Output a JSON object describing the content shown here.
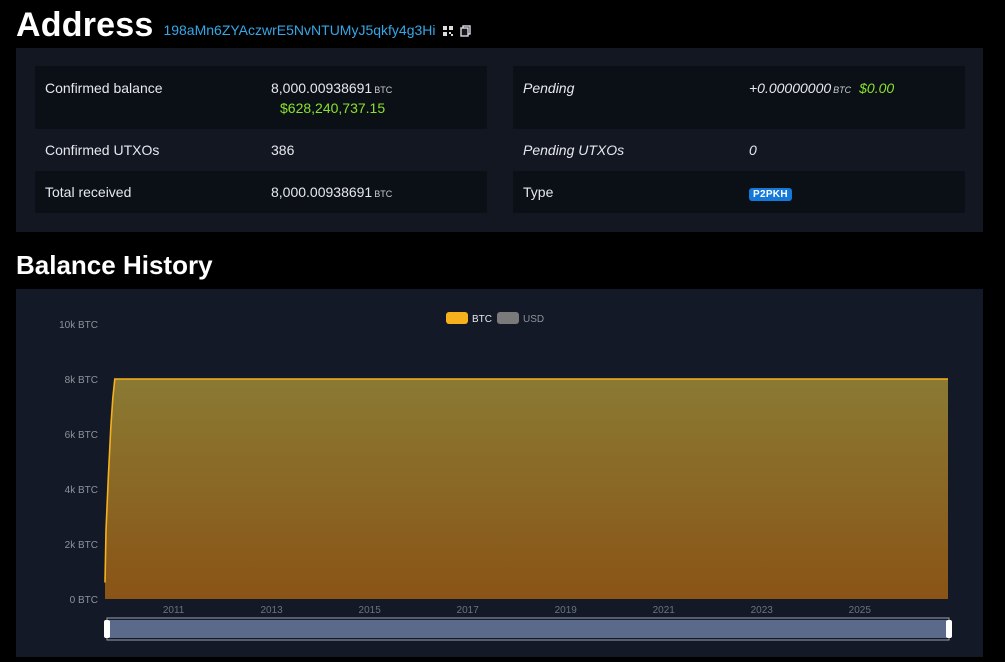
{
  "address": {
    "title": "Address",
    "hash": "198aMn6ZYAczwrE5NvNTUMyJ5qkfy4g3Hi"
  },
  "summary": {
    "confirmed_balance": {
      "label": "Confirmed balance",
      "value": "8,000.00938691",
      "unit": "BTC",
      "usd": "$628,240,737.15"
    },
    "pending": {
      "label": "Pending",
      "value": "+0.00000000",
      "unit": "BTC",
      "usd": "$0.00"
    },
    "confirmed_utxos": {
      "label": "Confirmed UTXOs",
      "value": "386"
    },
    "pending_utxos": {
      "label": "Pending UTXOs",
      "value": "0"
    },
    "total_received": {
      "label": "Total received",
      "value": "8,000.00938691",
      "unit": "BTC"
    },
    "type": {
      "label": "Type",
      "value": "P2PKH"
    }
  },
  "balance_history": {
    "title": "Balance History"
  },
  "colors": {
    "btc": "#f7b11c",
    "usd": "#7a7a7a",
    "accent": "#35a7e8",
    "usd_text": "#8ae22b",
    "badge": "#1479d8"
  },
  "chart_data": {
    "type": "area",
    "title": "",
    "xlabel": "",
    "ylabel": "",
    "legend": {
      "placement": "top-center",
      "entries": [
        "BTC",
        "USD"
      ]
    },
    "y_ticks": [
      "0 BTC",
      "2k BTC",
      "4k BTC",
      "6k BTC",
      "8k BTC",
      "10k BTC"
    ],
    "x_ticks": [
      "2011",
      "2013",
      "2015",
      "2017",
      "2019",
      "2021",
      "2023",
      "2025"
    ],
    "ylim": [
      0,
      10000
    ],
    "xlim": [
      2009.6,
      2026.8
    ],
    "series": [
      {
        "name": "BTC",
        "x": [
          2009.6,
          2009.62,
          2009.67,
          2009.72,
          2009.76,
          2009.8,
          2026.8
        ],
        "values": [
          600,
          2500,
          4500,
          6300,
          7300,
          8000,
          8000
        ]
      }
    ],
    "grid": false
  }
}
